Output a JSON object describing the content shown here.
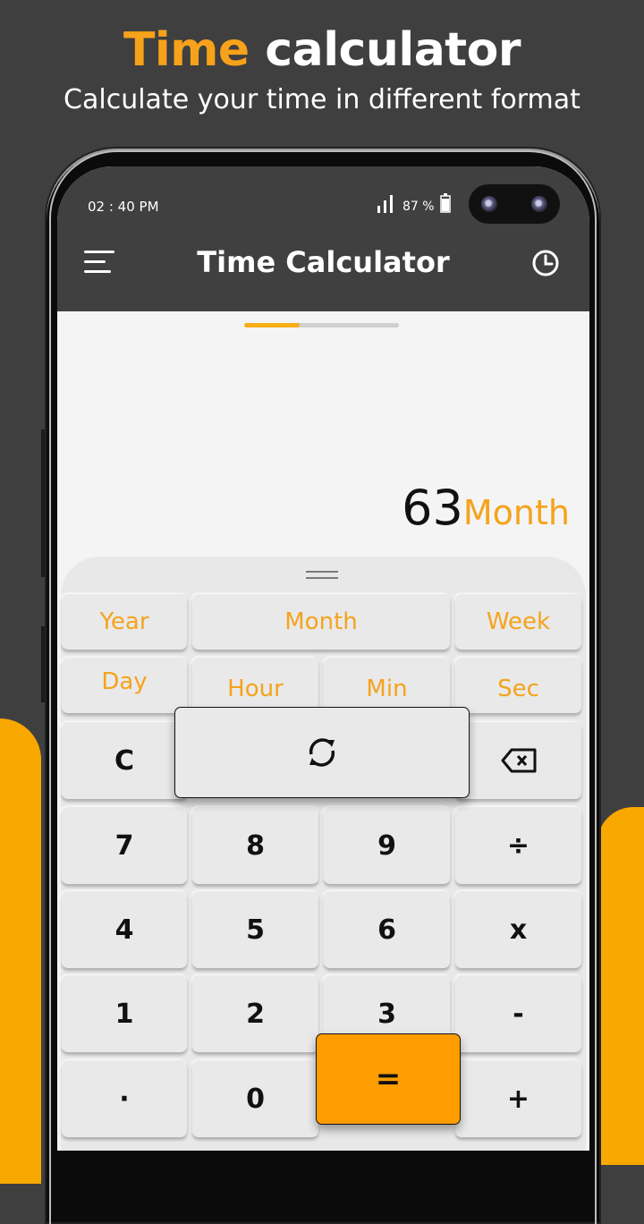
{
  "promo": {
    "title_accent": "Time",
    "title_rest": " calculator",
    "subtitle": "Calculate your time in different format"
  },
  "status_bar": {
    "time": "02 : 40 PM",
    "battery": "87 %",
    "signal_icon": "signal-icon",
    "battery_icon": "battery-icon"
  },
  "app_bar": {
    "title": "Time Calculator",
    "menu_icon": "hamburger-menu-icon",
    "history_icon": "clock-icon"
  },
  "progress": {
    "fraction": 0.36
  },
  "display": {
    "value": "63",
    "unit": "Month"
  },
  "colors": {
    "accent": "#f5a31c",
    "equals": "#ff9d00",
    "appbar": "#404040",
    "key": "#e9e9e9"
  },
  "unit_keys": [
    "Year",
    "Month",
    "Week",
    "Day",
    "Hour",
    "Min",
    "Sec"
  ],
  "keys": {
    "clear": "C",
    "convert_icon": "refresh-icon",
    "backspace_icon": "backspace-icon",
    "seven": "7",
    "eight": "8",
    "nine": "9",
    "divide": "÷",
    "four": "4",
    "five": "5",
    "six": "6",
    "multiply": "x",
    "one": "1",
    "two": "2",
    "three": "3",
    "minus": "-",
    "dot": "·",
    "zero": "0",
    "equals": "=",
    "plus": "+"
  }
}
